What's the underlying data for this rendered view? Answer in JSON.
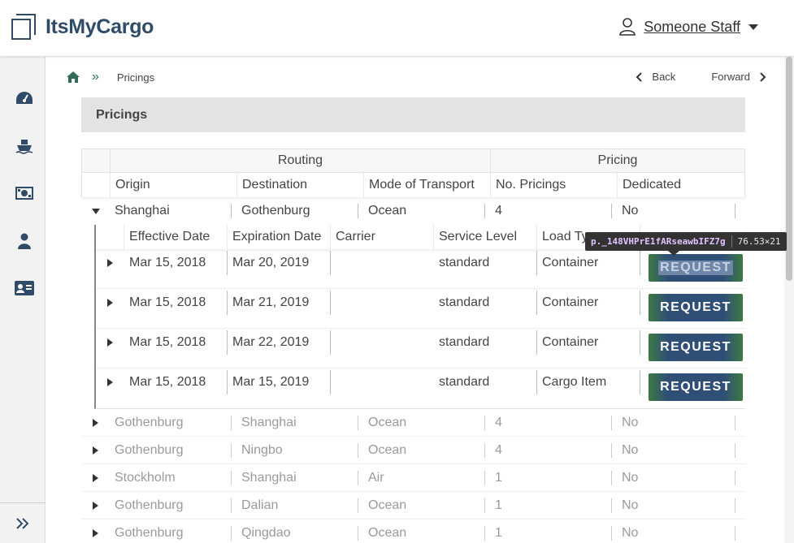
{
  "header": {
    "app_name": "ItsMyCargo",
    "user_name": "Someone Staff"
  },
  "sidebar": {
    "items": [
      "dashboard-icon",
      "ship-icon",
      "money-icon",
      "user-icon",
      "contact-card-icon"
    ],
    "collapse_icon": "double-chevron-right-icon"
  },
  "breadcrumb": {
    "current": "Pricings"
  },
  "nav": {
    "back": "Back",
    "forward": "Forward"
  },
  "page": {
    "title": "Pricings"
  },
  "table": {
    "groups": {
      "routing": "Routing",
      "pricing": "Pricing"
    },
    "columns": {
      "origin": "Origin",
      "destination": "Destination",
      "mode": "Mode of Transport",
      "count": "No. Pricings",
      "dedicated": "Dedicated"
    },
    "expanded_row": {
      "origin": "Shanghai",
      "destination": "Gothenburg",
      "mode": "Ocean",
      "count": "4",
      "dedicated": "No"
    },
    "sub_columns": {
      "effective": "Effective Date",
      "expiration": "Expiration Date",
      "carrier": "Carrier",
      "service": "Service Level",
      "load": "Load Ty"
    },
    "sub_rows": [
      {
        "effective": "Mar 15, 2018",
        "expiration": "Mar 20, 2019",
        "carrier": "",
        "service": "standard",
        "load": "Container",
        "action": "REQUEST"
      },
      {
        "effective": "Mar 15, 2018",
        "expiration": "Mar 21, 2019",
        "carrier": "",
        "service": "standard",
        "load": "Container",
        "action": "REQUEST"
      },
      {
        "effective": "Mar 15, 2018",
        "expiration": "Mar 22, 2019",
        "carrier": "",
        "service": "standard",
        "load": "Container",
        "action": "REQUEST"
      },
      {
        "effective": "Mar 15, 2018",
        "expiration": "Mar 15, 2019",
        "carrier": "",
        "service": "standard",
        "load": "Cargo Item",
        "action": "REQUEST"
      }
    ],
    "rows": [
      {
        "origin": "Gothenburg",
        "destination": "Shanghai",
        "mode": "Ocean",
        "count": "4",
        "dedicated": "No"
      },
      {
        "origin": "Gothenburg",
        "destination": "Ningbo",
        "mode": "Ocean",
        "count": "4",
        "dedicated": "No"
      },
      {
        "origin": "Stockholm",
        "destination": "Shanghai",
        "mode": "Air",
        "count": "1",
        "dedicated": "No"
      },
      {
        "origin": "Gothenburg",
        "destination": "Dalian",
        "mode": "Ocean",
        "count": "1",
        "dedicated": "No"
      },
      {
        "origin": "Gothenburg",
        "destination": "Qingdao",
        "mode": "Ocean",
        "count": "1",
        "dedicated": "No"
      }
    ]
  },
  "tooltip": {
    "selector": "p._148VHPrE1fARseawbIFZ7g",
    "size": "76.53×21"
  },
  "colors": {
    "brand": "#2f4b67",
    "button": "#2f4f77",
    "accent_green": "#3e7a43"
  }
}
